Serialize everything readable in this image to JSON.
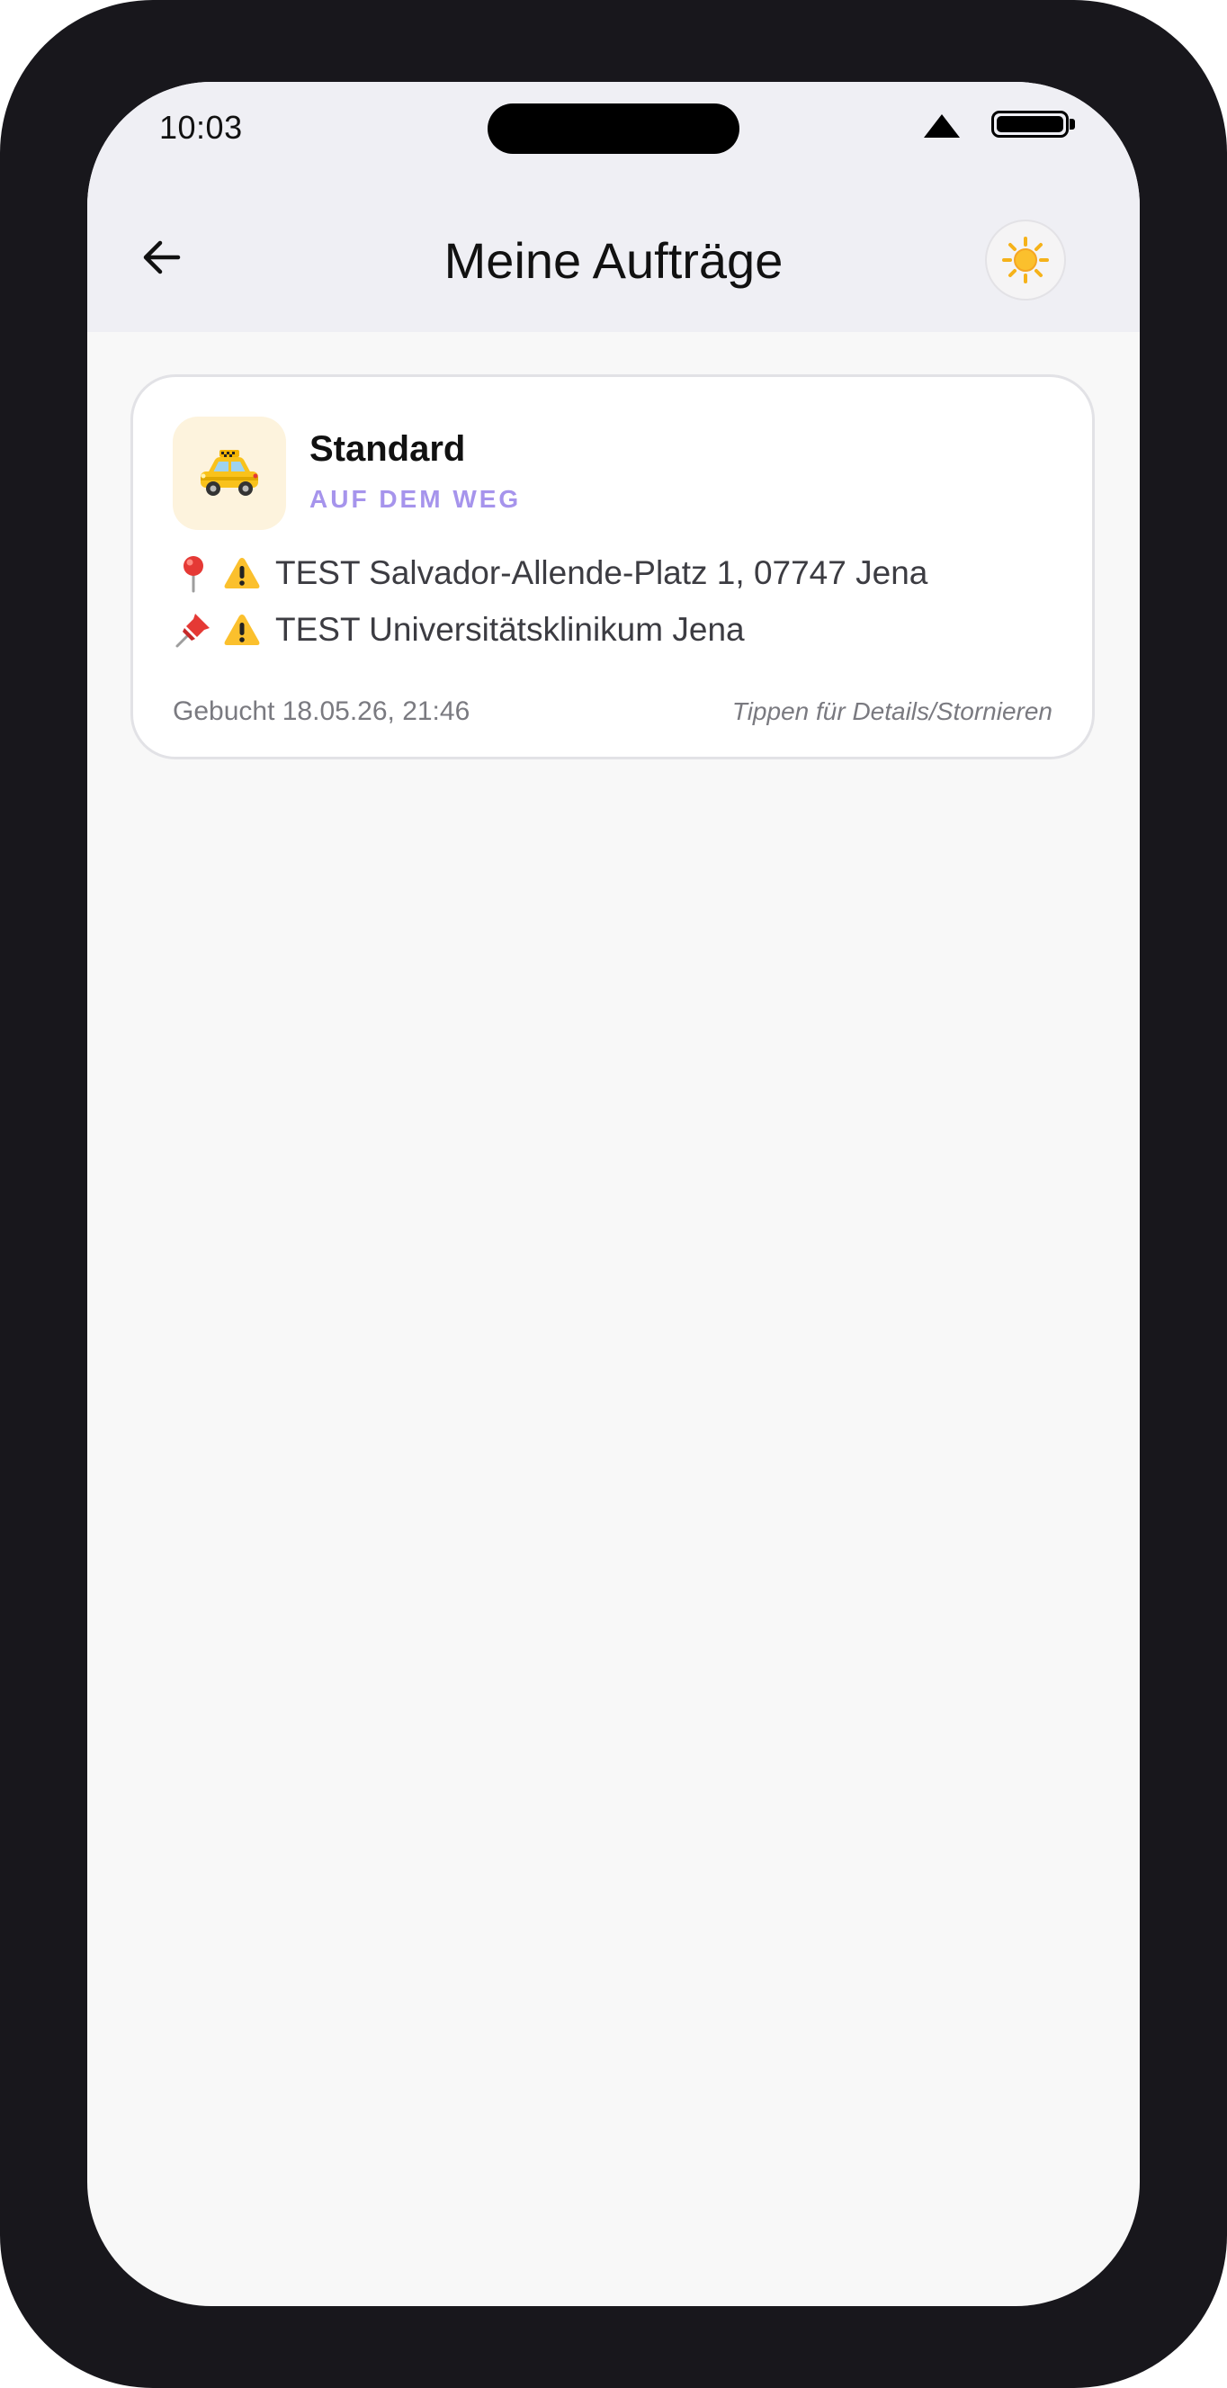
{
  "status_bar": {
    "time": "10:03"
  },
  "header": {
    "title": "Meine Aufträge",
    "back_icon": "arrow-left-icon",
    "theme_icon": "sun-icon"
  },
  "orders": [
    {
      "type": "Standard",
      "status": "AUF DEM WEG",
      "vehicle_icon": "taxi-icon",
      "pickup": "TEST Salvador-Allende-Platz 1, 07747 Jena",
      "pickup_icon": "map-pin-icon",
      "destination": "TEST Universitätsklinikum Jena",
      "destination_icon": "pushpin-icon",
      "warning_icon": "warning-icon",
      "booked": "Gebucht 18.05.26, 21:46",
      "hint": "Tippen für Details/Stornieren"
    }
  ],
  "colors": {
    "accent": "#a694ec",
    "header_bg": "#efeff4",
    "page_bg": "#f8f8f8",
    "device_frame": "#18171c"
  }
}
